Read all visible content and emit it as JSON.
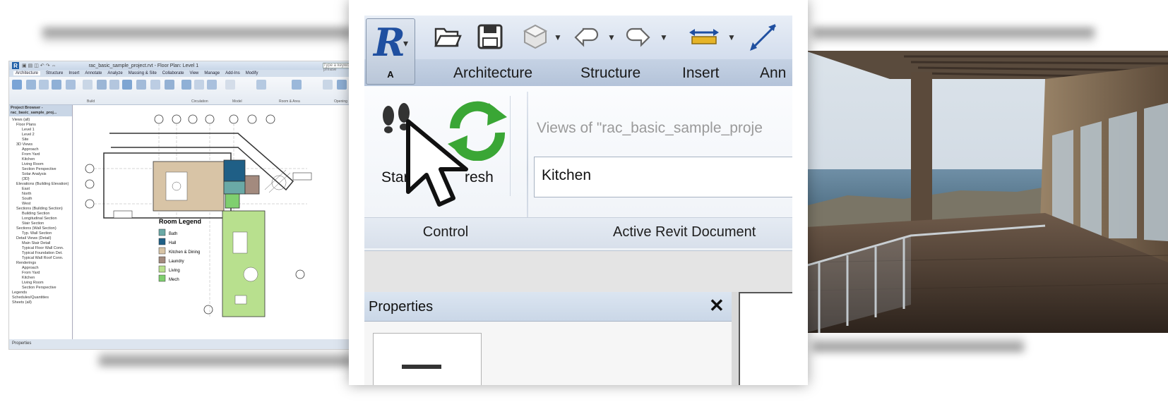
{
  "left_screenshot": {
    "window_title": "rac_basic_sample_project.rvt - Floor Plan: Level 1",
    "search_placeholder": "Type a keyword or phrase",
    "tabs": [
      "Architecture",
      "Structure",
      "Insert",
      "Annotate",
      "Analyze",
      "Massing & Site",
      "Collaborate",
      "View",
      "Manage",
      "Add-Ins",
      "Modify"
    ],
    "ribbon_groups": [
      "Build",
      "Circulation",
      "Model",
      "Room & Area",
      "Opening"
    ],
    "browser_title": "Project Browser - rac_basic_sample_proj...",
    "browser_items": [
      "Views (all)",
      "Floor Plans",
      "Level 1",
      "Level 2",
      "Site",
      "3D Views",
      "Approach",
      "From Yard",
      "Kitchen",
      "Living Room",
      "Section Perspective",
      "Solar Analysis",
      "{3D}",
      "Elevations (Building Elevation)",
      "East",
      "North",
      "South",
      "West",
      "Sections (Building Section)",
      "Building Section",
      "Longitudinal Section",
      "Stair Section",
      "Sections (Wall Section)",
      "Typ. Wall Section",
      "Detail Views (Detail)",
      "Main Stair Detail",
      "Typical Floor Wall Conn.",
      "Typical Foundation Det.",
      "Typical Wall Roof Conn.",
      "Renderings",
      "Approach",
      "From Yard",
      "Kitchen",
      "Living Room",
      "Section Perspective",
      "Legends",
      "Schedules/Quantities",
      "Sheets (all)"
    ],
    "legend_title": "Room Legend",
    "legend_items": [
      {
        "label": "Bath",
        "color": "#6aa9a6"
      },
      {
        "label": "Hall",
        "color": "#1f5f86"
      },
      {
        "label": "Kitchen & Dining",
        "color": "#d8c4a6"
      },
      {
        "label": "Laundry",
        "color": "#a38a7e"
      },
      {
        "label": "Living",
        "color": "#b8e08e"
      },
      {
        "label": "Mech",
        "color": "#7fcf6f"
      }
    ],
    "status_text": "Properties"
  },
  "qat": {
    "app_letter": "A",
    "icons": [
      "open-icon",
      "save-icon",
      "sync-icon",
      "undo-icon",
      "redo-icon",
      "measure-icon",
      "dimension-icon"
    ]
  },
  "ribbon_tabs": [
    "Architecture",
    "Structure",
    "Insert",
    "Ann"
  ],
  "control_panel": {
    "start_label": "Start",
    "refresh_label": "resh",
    "panel_title": "Control"
  },
  "document_panel": {
    "views_label": "Views of \"rac_basic_sample_proje",
    "selected_view": "Kitchen",
    "panel_title": "Active Revit Document"
  },
  "properties": {
    "title": "Properties",
    "close_label": "✕"
  },
  "colors": {
    "revit_blue": "#1f4fa0",
    "ribbon_tab_bg": "#b9c7db",
    "refresh_green": "#3aa635",
    "start_green": "#45a33a"
  }
}
